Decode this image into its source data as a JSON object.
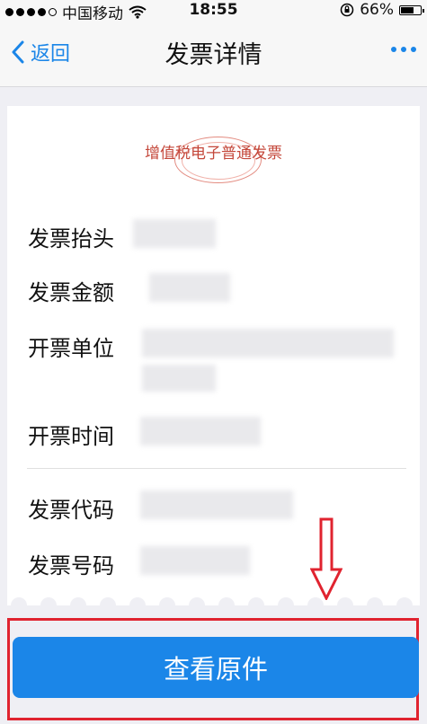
{
  "status_bar": {
    "carrier": "中国移动",
    "time": "18:55",
    "battery": "66%",
    "battery_level": 0.66
  },
  "nav": {
    "back_label": "返回",
    "title": "发票详情"
  },
  "invoice": {
    "type_label": "增值税电子普通发票",
    "fields": [
      {
        "label": "发票抬头"
      },
      {
        "label": "发票金额"
      },
      {
        "label": "开票单位"
      },
      {
        "label": "开票时间"
      },
      {
        "label": "发票代码"
      },
      {
        "label": "发票号码"
      }
    ]
  },
  "actions": {
    "view_original": "查看原件"
  },
  "colors": {
    "accent": "#1b86e8",
    "stamp_text": "#c4473a",
    "annotation_red": "#e0232f"
  },
  "icons": [
    "signal-dots-icon",
    "wifi-icon",
    "rotation-lock-icon",
    "battery-icon",
    "chevron-left-icon",
    "more-icon",
    "down-arrow-annotation"
  ]
}
